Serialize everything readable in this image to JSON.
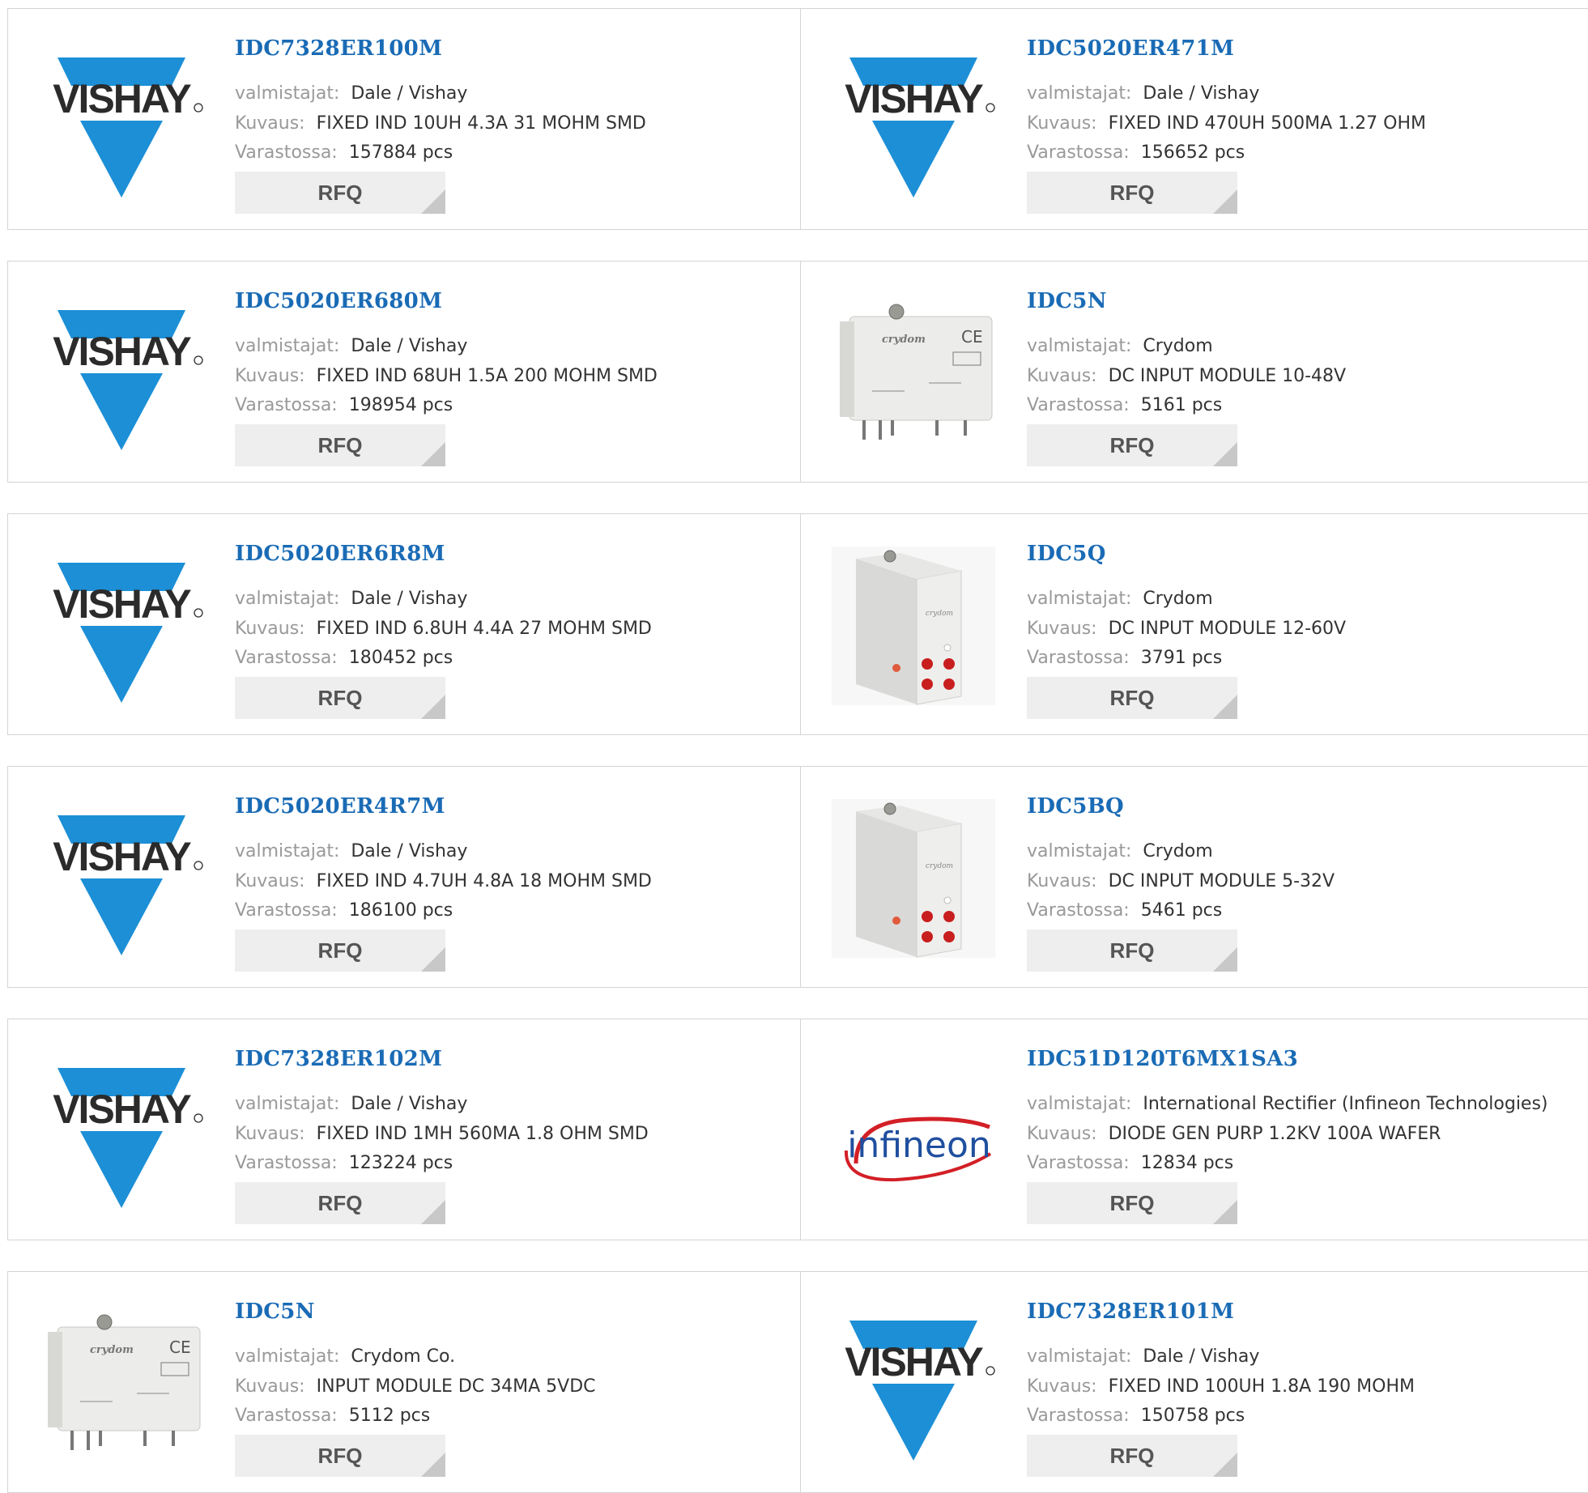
{
  "labels": {
    "manufacturer": "valmistajat:",
    "description": "Kuvaus:",
    "stock": "Varastossa:"
  },
  "rfq_label": "RFQ",
  "colors": {
    "part_link": "#1a6bb5",
    "vishay_blue": "#1c8fd6",
    "infineon_red": "#d31f26",
    "infineon_blue": "#1f4f9f",
    "button_bg": "#eeeeee"
  },
  "logos": {
    "vishay": "VISHAY",
    "infineon": "infineon",
    "crydom": "crydom"
  },
  "products": [
    {
      "part": "IDC7328ER100M",
      "manufacturer": "Dale / Vishay",
      "description": "FIXED IND 10UH 4.3A 31 MOHM SMD",
      "stock": "157884 pcs",
      "image": "vishay-logo"
    },
    {
      "part": "IDC5020ER471M",
      "manufacturer": "Dale / Vishay",
      "description": "FIXED IND 470UH 500MA 1.27 OHM",
      "stock": "156652 pcs",
      "image": "vishay-logo"
    },
    {
      "part": "IDC5020ER680M",
      "manufacturer": "Dale / Vishay",
      "description": "FIXED IND 68UH 1.5A 200 MOHM SMD",
      "stock": "198954 pcs",
      "image": "vishay-logo"
    },
    {
      "part": "IDC5N",
      "manufacturer": "Crydom",
      "description": "DC INPUT MODULE 10-48V",
      "stock": "5161 pcs",
      "image": "crydom-module-photo"
    },
    {
      "part": "IDC5020ER6R8M",
      "manufacturer": "Dale / Vishay",
      "description": "FIXED IND 6.8UH 4.4A 27 MOHM SMD",
      "stock": "180452 pcs",
      "image": "vishay-logo"
    },
    {
      "part": "IDC5Q",
      "manufacturer": "Crydom",
      "description": "DC INPUT MODULE 12-60V",
      "stock": "3791 pcs",
      "image": "crydom-led-module-photo"
    },
    {
      "part": "IDC5020ER4R7M",
      "manufacturer": "Dale / Vishay",
      "description": "FIXED IND 4.7UH 4.8A 18 MOHM SMD",
      "stock": "186100 pcs",
      "image": "vishay-logo"
    },
    {
      "part": "IDC5BQ",
      "manufacturer": "Crydom",
      "description": "DC INPUT MODULE 5-32V",
      "stock": "5461 pcs",
      "image": "crydom-led-module-photo"
    },
    {
      "part": "IDC7328ER102M",
      "manufacturer": "Dale / Vishay",
      "description": "FIXED IND 1MH 560MA 1.8 OHM SMD",
      "stock": "123224 pcs",
      "image": "vishay-logo"
    },
    {
      "part": "IDC51D120T6MX1SA3",
      "manufacturer": "International Rectifier (Infineon Technologies)",
      "description": "DIODE GEN PURP 1.2KV 100A WAFER",
      "stock": "12834 pcs",
      "image": "infineon-logo"
    },
    {
      "part": "IDC5N",
      "manufacturer": "Crydom Co.",
      "description": "INPUT MODULE DC 34MA 5VDC",
      "stock": "5112 pcs",
      "image": "crydom-module-photo"
    },
    {
      "part": "IDC7328ER101M",
      "manufacturer": "Dale / Vishay",
      "description": "FIXED IND 100UH 1.8A 190 MOHM",
      "stock": "150758 pcs",
      "image": "vishay-logo"
    }
  ]
}
